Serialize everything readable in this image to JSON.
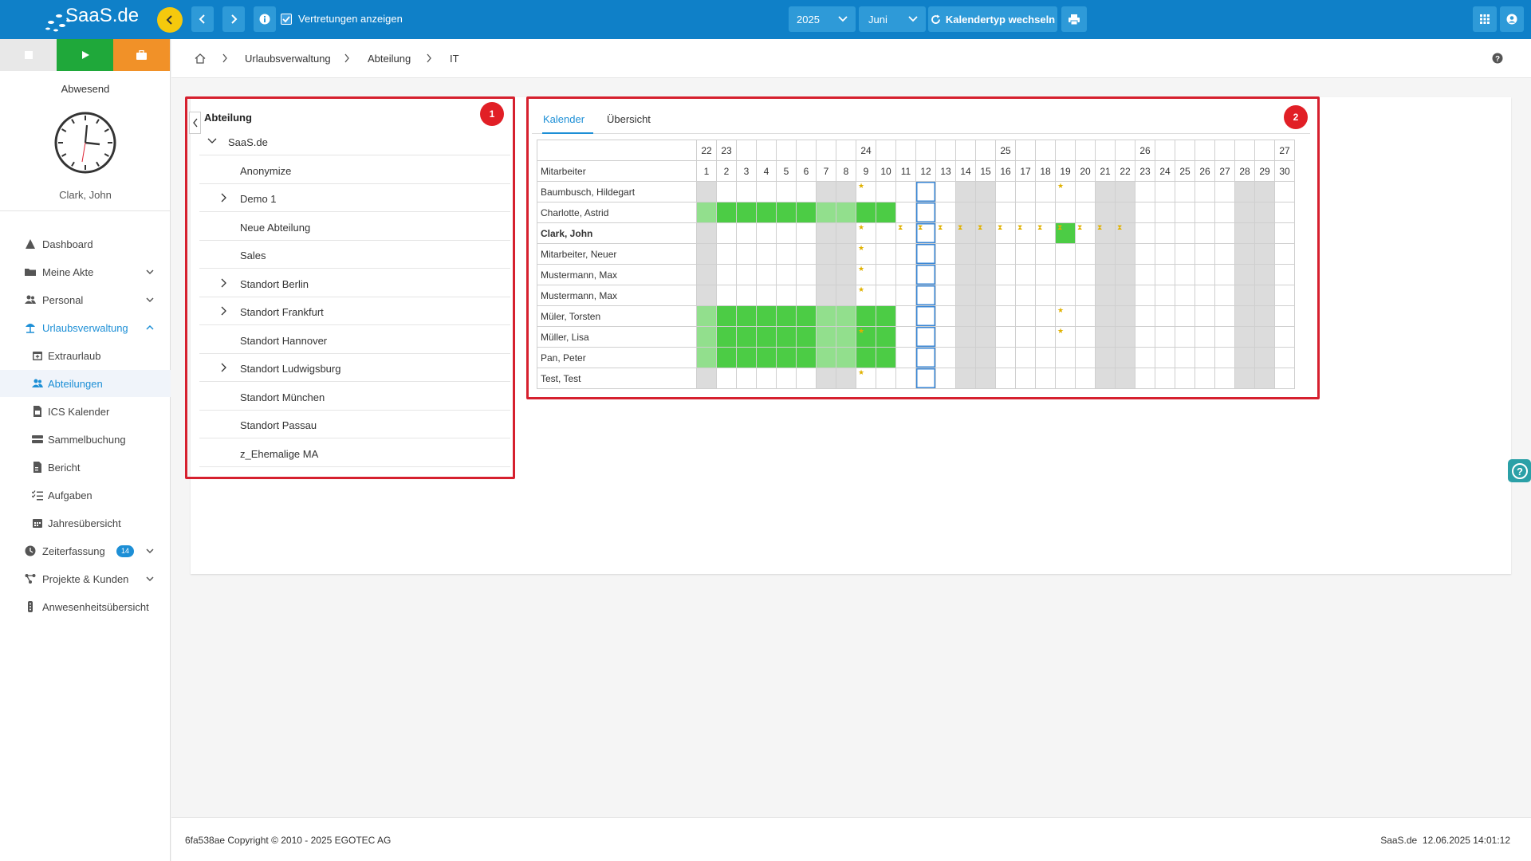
{
  "topbar": {
    "logo": "SaaS.de",
    "substitutes": "Vertretungen anzeigen",
    "year": "2025",
    "month": "Juni",
    "switch_calendar": "Kalendertyp wechseln"
  },
  "sidebar": {
    "status": "Abwesend",
    "user": "Clark, John",
    "items": [
      {
        "label": "Dashboard",
        "icon": "dashboard-icon"
      },
      {
        "label": "Meine Akte",
        "icon": "folder-icon"
      },
      {
        "label": "Personal",
        "icon": "people-icon"
      },
      {
        "label": "Urlaubsverwaltung",
        "icon": "beach-umbrella-icon"
      },
      {
        "label": "Extraurlaub",
        "icon": "calendar-plus-icon"
      },
      {
        "label": "Abteilungen",
        "icon": "people-icon"
      },
      {
        "label": "ICS Kalender",
        "icon": "file-calendar-icon"
      },
      {
        "label": "Sammelbuchung",
        "icon": "stack-icon"
      },
      {
        "label": "Bericht",
        "icon": "report-icon"
      },
      {
        "label": "Aufgaben",
        "icon": "tasks-icon"
      },
      {
        "label": "Jahresübersicht",
        "icon": "calendar-icon"
      },
      {
        "label": "Zeiterfassung",
        "icon": "clock-icon",
        "badge": "14"
      },
      {
        "label": "Projekte & Kunden",
        "icon": "projects-icon"
      },
      {
        "label": "Anwesenheitsübersicht",
        "icon": "presence-icon"
      }
    ]
  },
  "breadcrumb": [
    "Urlaubsverwaltung",
    "Abteilung",
    "IT"
  ],
  "tree": {
    "title": "Abteilung",
    "marker": "1",
    "items": [
      "SaaS.de",
      "Anonymize",
      "Demo 1",
      "Neue Abteilung",
      "Sales",
      "Standort Berlin",
      "Standort Frankfurt",
      "Standort Hannover",
      "Standort Ludwigsburg",
      "Standort München",
      "Standort Passau",
      "z_Ehemalige MA"
    ]
  },
  "calendar": {
    "marker": "2",
    "tabs": [
      "Kalender",
      "Übersicht"
    ],
    "header": "Mitarbeiter",
    "weeks": [
      "22",
      "23",
      "24",
      "25",
      "26",
      "27"
    ],
    "days": [
      "1",
      "2",
      "3",
      "4",
      "5",
      "6",
      "7",
      "8",
      "9",
      "10",
      "11",
      "12",
      "13",
      "14",
      "15",
      "16",
      "17",
      "18",
      "19",
      "20",
      "21",
      "22",
      "23",
      "24",
      "25",
      "26",
      "27",
      "28",
      "29",
      "30"
    ],
    "employees": [
      "Baumbusch, Hildegart",
      "Charlotte, Astrid",
      "Clark, John",
      "Mitarbeiter, Neuer",
      "Mustermann, Max",
      "Mustermann, Max",
      "Müler, Torsten",
      "Müller, Lisa",
      "Pan, Peter",
      "Test, Test"
    ]
  },
  "footer": {
    "copyright": "6fa538ae Copyright © 2010 - 2025 EGOTEC AG",
    "right": "SaaS.de  12.06.2025 14:01:12"
  }
}
